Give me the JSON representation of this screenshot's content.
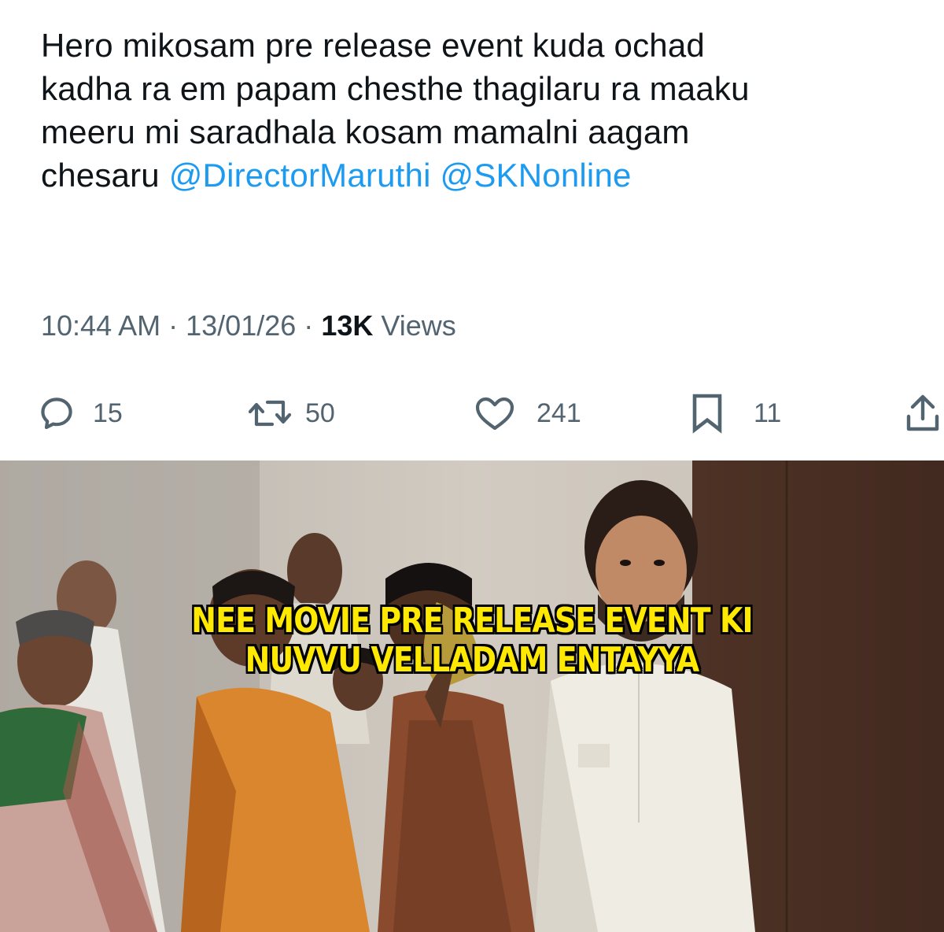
{
  "tweet": {
    "text_lines": [
      "Hero mikosam pre release event kuda ochad",
      "kadha ra em papam chesthe thagilaru ra maaku",
      "meeru mi saradhala kosam mamalni aagam",
      "chesaru"
    ],
    "mentions": [
      "@DirectorMaruthi",
      "@SKNonline"
    ],
    "time": "10:44 AM",
    "date": "13/01/26",
    "separator": "·",
    "views_count": "13K",
    "views_label": "Views",
    "actions": {
      "reply": {
        "icon": "reply-icon",
        "count": "15"
      },
      "retweet": {
        "icon": "retweet-icon",
        "count": "50"
      },
      "like": {
        "icon": "heart-icon",
        "count": "241"
      },
      "bookmark": {
        "icon": "bookmark-icon",
        "count": "11"
      },
      "share": {
        "icon": "share-icon"
      }
    }
  },
  "meme": {
    "caption_lines": [
      "NEE MOVIE PRE RELEASE EVENT KI",
      "NUVVU VELLADAM ENTAYYA"
    ]
  },
  "colors": {
    "text": "#0f1419",
    "secondary": "#536471",
    "mention": "#1d9bf0",
    "caption": "#ffe900"
  }
}
